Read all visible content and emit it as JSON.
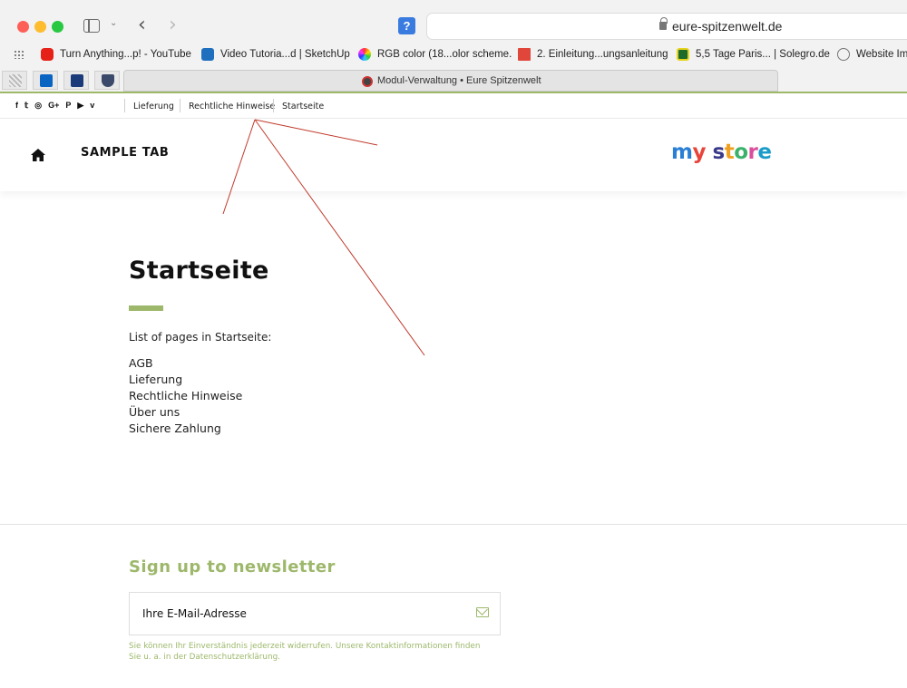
{
  "browser": {
    "url": "eure-spitzenwelt.de",
    "tab_title": "Modul-Verwaltung • Eure Spitzenwelt",
    "bookmarks": [
      {
        "label": "Turn Anything...p! - YouTube",
        "color": "#e62117"
      },
      {
        "label": "Video Tutoria...d | SketchUp",
        "color": "#1f6fbf"
      },
      {
        "label": "RGB color (18...olor scheme.",
        "color": "#c43be0"
      },
      {
        "label": "2. Einleitung...ungsanleitung",
        "color": "#e0463a"
      },
      {
        "label": "5,5 Tage Paris... | Solegro.de",
        "color": "#1d6a2a"
      },
      {
        "label": "Website Imp",
        "color": "#777777"
      }
    ],
    "pinned_tabs": [
      "pinned-tab-grid-icon",
      "outlook-icon",
      "gmx-icon",
      "shield-icon"
    ]
  },
  "topnav": {
    "social_icons": [
      "f",
      "t",
      "ig",
      "G+",
      "P",
      "yt",
      "v"
    ],
    "links": [
      "Lieferung",
      "Rechtliche Hinweise",
      "Startseite"
    ]
  },
  "header": {
    "menu_label": "SAMPLE TAB",
    "logo_text": "my store"
  },
  "main": {
    "title": "Startseite",
    "intro": "List of pages in Startseite:",
    "pages": [
      "AGB",
      "Lieferung",
      "Rechtliche Hinweise",
      "Über uns",
      "Sichere Zahlung"
    ]
  },
  "newsletter": {
    "title": "Sign up to newsletter",
    "placeholder": "Ihre E-Mail-Adresse",
    "note": "Sie können Ihr Einverständnis jederzeit widerrufen. Unsere Kontaktinformationen finden Sie u. a. in der Datenschutzerklärung."
  },
  "colors": {
    "accent": "#9db86b",
    "annotation": "#c0392b"
  }
}
